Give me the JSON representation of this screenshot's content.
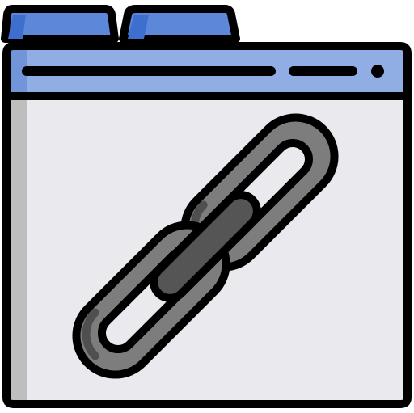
{
  "icon": {
    "name": "browser-link-icon",
    "depicts": [
      "browser-window-icon",
      "chain-link-icon"
    ]
  },
  "colors": {
    "outline": "#000000",
    "tab_fill": "#5D88DA",
    "tab_shade": "#3E6FCE",
    "toolbar_fill": "#90AEE4",
    "toolbar_shade": "#7096D9",
    "window_fill": "#E9E9EE",
    "side_shade": "#BEBEBE",
    "chain_fill": "#7D7D7D",
    "chain_shade": "#4F4F4F",
    "connector_fill": "#555555"
  }
}
